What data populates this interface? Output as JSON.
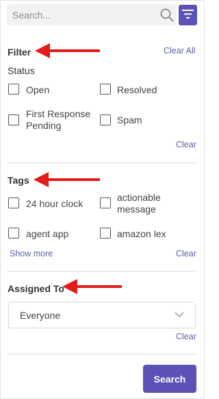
{
  "search": {
    "placeholder": "Search..."
  },
  "filter": {
    "title": "Filter",
    "clear_all": "Clear All"
  },
  "status": {
    "title": "Status",
    "options": [
      "Open",
      "Resolved",
      "First Response\nPending",
      "Spam"
    ],
    "clear": "Clear"
  },
  "tags": {
    "title": "Tags",
    "options": [
      "24 hour clock",
      "actionable\nmessage",
      "agent app",
      "amazon lex"
    ],
    "show_more": "Show more",
    "clear": "Clear"
  },
  "assigned": {
    "title": "Assigned To",
    "value": "Everyone",
    "clear": "Clear"
  },
  "search_button": {
    "label": "Search"
  },
  "colors": {
    "accent": "#5b51b6",
    "link": "#5b5fa6",
    "annotation_arrow": "#e31b1b"
  }
}
